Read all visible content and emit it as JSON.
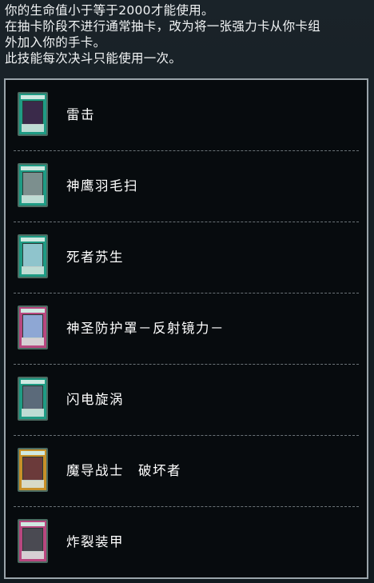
{
  "description": {
    "lines": [
      "你的生命值小于等于2000才能使用。",
      "在抽卡阶段不进行通常抽卡，改为将一张强力卡从你卡组",
      "外加入你的手卡。",
      "此技能每次决斗只能使用一次。"
    ]
  },
  "cards": [
    {
      "name": "雷击",
      "frame_color": "#1f9b84",
      "art_color": "#3a2a4a",
      "icon": "lightning-bolt-card-art-icon"
    },
    {
      "name": "神鹰羽毛扫",
      "frame_color": "#1f9b84",
      "art_color": "#7c8f8e",
      "icon": "feather-duster-card-art-icon"
    },
    {
      "name": "死者苏生",
      "frame_color": "#1f9b84",
      "art_color": "#8fc4cc",
      "icon": "ankh-card-art-icon"
    },
    {
      "name": "神圣防护罩－反射镜力－",
      "frame_color": "#b8477f",
      "art_color": "#8ea7d4",
      "icon": "mirror-force-card-art-icon"
    },
    {
      "name": "闪电旋涡",
      "frame_color": "#1f9b84",
      "art_color": "#5b6a7a",
      "icon": "lightning-vortex-card-art-icon"
    },
    {
      "name": "魔导战士　破坏者",
      "frame_color": "#c79028",
      "art_color": "#6b3a3a",
      "icon": "breaker-magical-warrior-card-art-icon"
    },
    {
      "name": "炸裂装甲",
      "frame_color": "#b8477f",
      "art_color": "#4a4a52",
      "icon": "sakuretsu-armor-card-art-icon"
    }
  ]
}
